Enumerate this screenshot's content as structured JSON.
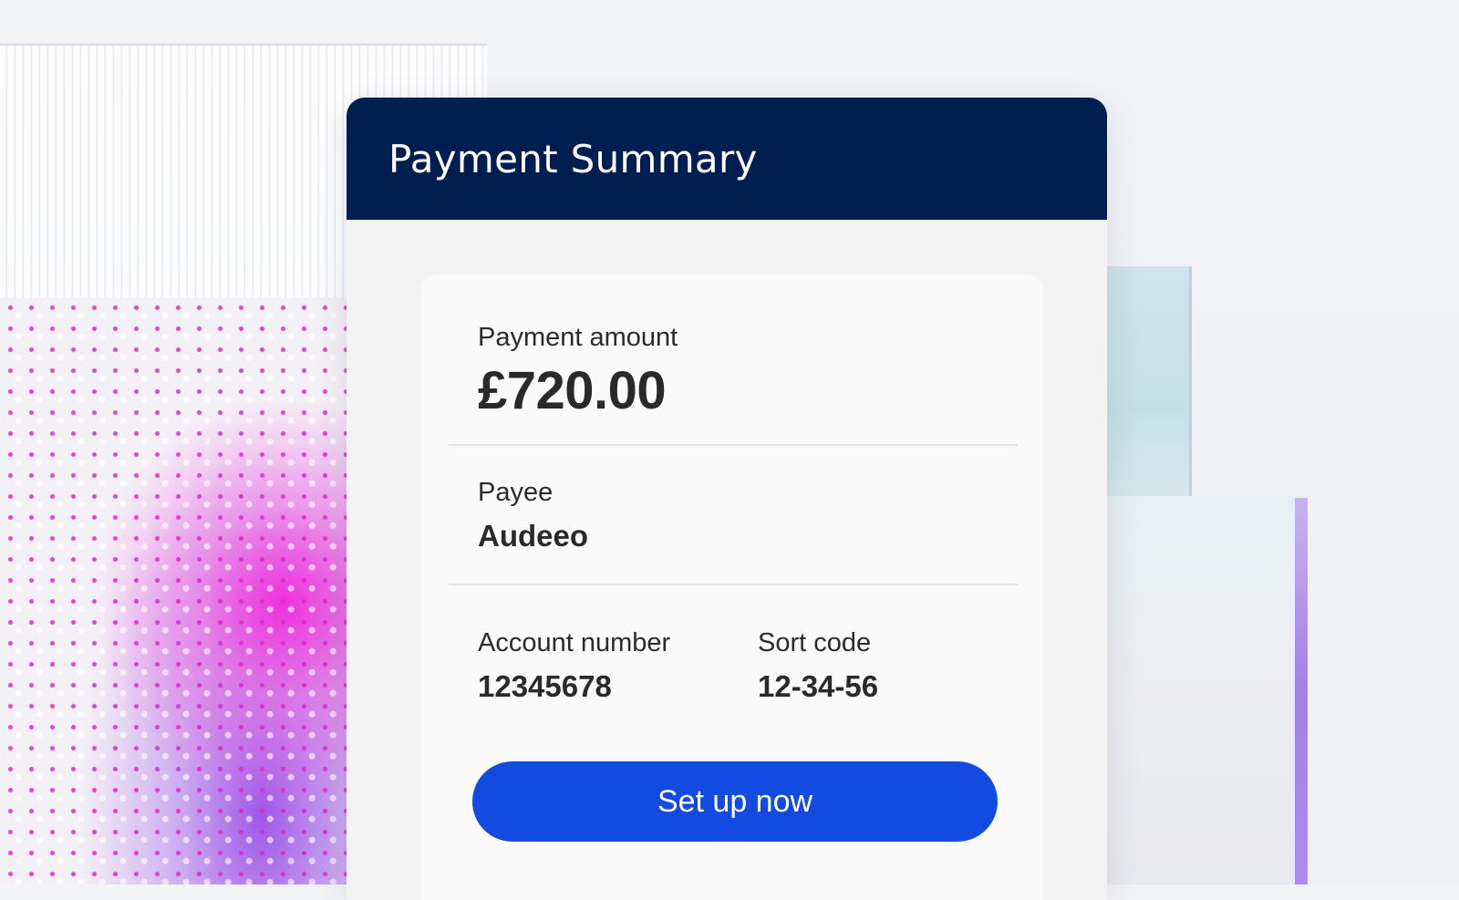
{
  "card": {
    "title": "Payment Summary"
  },
  "payment": {
    "amount_label": "Payment amount",
    "amount_value": "£720.00",
    "payee_label": "Payee",
    "payee_value": "Audeeo",
    "account_number_label": "Account number",
    "account_number_value": "12345678",
    "sort_code_label": "Sort code",
    "sort_code_value": "12-34-56"
  },
  "actions": {
    "primary_label": "Set up now"
  },
  "colors": {
    "header_bg": "#011e50",
    "button_bg": "#134ae0",
    "accent_magenta": "#e829d6",
    "accent_purple": "#a67ee8"
  }
}
